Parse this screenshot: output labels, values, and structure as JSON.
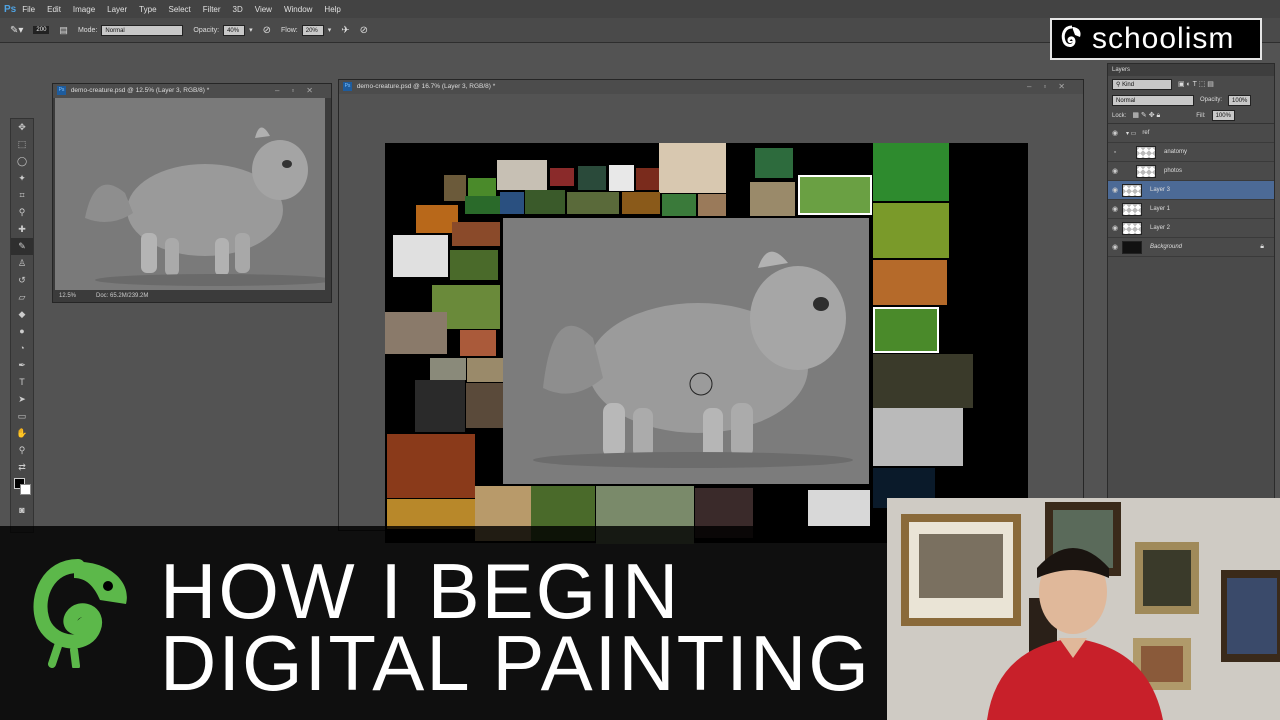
{
  "app": {
    "menu": [
      "File",
      "Edit",
      "Image",
      "Layer",
      "Type",
      "Select",
      "Filter",
      "3D",
      "View",
      "Window",
      "Help"
    ]
  },
  "options": {
    "brush_size": "200",
    "mode_label": "Mode:",
    "mode_value": "Normal",
    "opacity_label": "Opacity:",
    "opacity_value": "40%",
    "flow_label": "Flow:",
    "flow_value": "20%"
  },
  "nav_window": {
    "title": "demo-creature.psd @ 12.5% (Layer 3, RGB/8) *",
    "zoom": "12.5%",
    "doc": "Doc: 65.2M/239.2M"
  },
  "main_window": {
    "title": "demo-creature.psd @ 16.7% (Layer 3, RGB/8) *"
  },
  "layers_panel": {
    "tab": "Layers",
    "kind_label": "Kind",
    "blend_mode": "Normal",
    "opacity_label": "Opacity:",
    "opacity_value": "100%",
    "lock_label": "Lock:",
    "fill_label": "Fill:",
    "fill_value": "100%",
    "layers": [
      {
        "name": "ref",
        "type": "group",
        "visible": true,
        "selected": false
      },
      {
        "name": "anatomy",
        "type": "layer",
        "visible": false,
        "selected": false
      },
      {
        "name": "photos",
        "type": "layer",
        "visible": true,
        "selected": false
      },
      {
        "name": "Layer 3",
        "type": "layer",
        "visible": true,
        "selected": true
      },
      {
        "name": "Layer 1",
        "type": "layer",
        "visible": true,
        "selected": false
      },
      {
        "name": "Layer 2",
        "type": "layer",
        "visible": true,
        "selected": false
      },
      {
        "name": "Background",
        "type": "background",
        "visible": true,
        "selected": false
      }
    ]
  },
  "brand": {
    "name": "schoolism"
  },
  "overlay": {
    "line1": "HOW I BEGIN",
    "line2": "DIGITAL PAINTING"
  },
  "colors": {
    "accent_green": "#5cb84a",
    "selection_blue": "#4c6a96"
  }
}
